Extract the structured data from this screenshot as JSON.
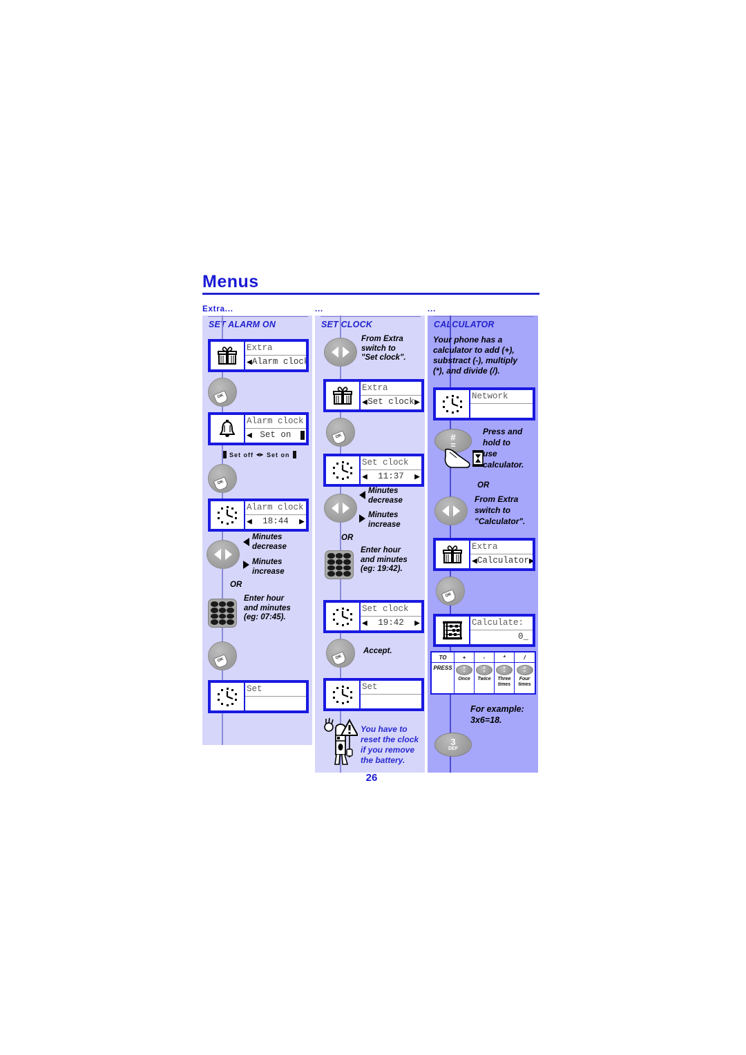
{
  "page": {
    "title": "Menus",
    "number": "26"
  },
  "columns": [
    {
      "header": "Extra...",
      "title": "SET ALARM ON",
      "steps": {
        "screen1": {
          "icon": "gift-icon",
          "line_top": "Extra",
          "line_bottom": "Alarm clock"
        },
        "key1": {
          "icon": "ok-key",
          "label": "OK"
        },
        "screen2": {
          "icon": "bell-icon",
          "line_top": "Alarm clock",
          "line_bottom": "Set on"
        },
        "toggle_hint": {
          "left": "Set off",
          "right": "Set on"
        },
        "key2": {
          "icon": "ok-key",
          "label": "OK"
        },
        "screen3": {
          "icon": "clock-icon",
          "line_top": "Alarm clock",
          "line_bottom": "18:44"
        },
        "nav_key": {
          "icon": "left-right-key"
        },
        "callout_dec": "Minutes\ndecrease",
        "callout_dec_l1": "Minutes",
        "callout_dec_l2": "decrease",
        "callout_inc_l1": "Minutes",
        "callout_inc_l2": "increase",
        "or": "OR",
        "keypad": {
          "icon": "keypad-icon"
        },
        "callout_enter_l1": "Enter hour",
        "callout_enter_l2": "and minutes",
        "callout_enter_l3": "(eg: 07:45).",
        "key3": {
          "icon": "ok-key",
          "label": "OK"
        },
        "screen4": {
          "icon": "clock-icon",
          "line_top": "Set",
          "line_bottom": ""
        }
      }
    },
    {
      "header": "...",
      "title": "SET CLOCK",
      "steps": {
        "nav_key_top": {
          "icon": "left-right-key"
        },
        "callout_from_l1": "From Extra",
        "callout_from_l2": "switch to",
        "callout_from_l3": "\"Set clock\".",
        "screen1": {
          "icon": "gift-icon",
          "line_top": "Extra",
          "line_bottom": "Set clock"
        },
        "key1": {
          "icon": "ok-key",
          "label": "OK"
        },
        "screen2": {
          "icon": "clock-icon",
          "line_top": "Set clock",
          "line_bottom": "11:37"
        },
        "nav_key": {
          "icon": "left-right-key"
        },
        "callout_dec_l1": "Minutes",
        "callout_dec_l2": "decrease",
        "callout_inc_l1": "Minutes",
        "callout_inc_l2": "increase",
        "or": "OR",
        "keypad": {
          "icon": "keypad-icon"
        },
        "callout_enter_l1": "Enter hour",
        "callout_enter_l2": "and minutes",
        "callout_enter_l3": "(eg: 19:42).",
        "screen3": {
          "icon": "clock-icon",
          "line_top": "Set clock",
          "line_bottom": "19:42"
        },
        "key2": {
          "icon": "ok-key",
          "label": "OK"
        },
        "callout_accept": "Accept.",
        "screen4": {
          "icon": "clock-icon",
          "line_top": "Set",
          "line_bottom": ""
        },
        "warning": {
          "icon": "warning-character-icon",
          "l1": "You have to",
          "l2": "reset the clock",
          "l3": "if you remove",
          "l4": "the battery."
        }
      }
    },
    {
      "header": "...",
      "title": "CALCULATOR",
      "steps": {
        "intro_l1": "Your phone has a",
        "intro_l2": "calculator to add (+),",
        "intro_l3": "substract (-), multiply",
        "intro_l4": "(*), and divide (/).",
        "screen1": {
          "icon": "clock-icon",
          "line_top": "Network",
          "line_bottom": ""
        },
        "hash_key": {
          "icon": "hash-key",
          "top": "#",
          "bottom": "="
        },
        "hold_icon": "press-hold-icon",
        "callout_press_l1": "Press and",
        "callout_press_l2": "hold to",
        "callout_press_l3": "use",
        "callout_press_l4": "calculator.",
        "or": "OR",
        "nav_key": {
          "icon": "left-right-key"
        },
        "callout_from_l1": "From Extra",
        "callout_from_l2": "switch to",
        "callout_from_l3": "\"Calculator\".",
        "screen2": {
          "icon": "gift-icon",
          "line_top": "Extra",
          "line_bottom": "Calculator"
        },
        "key1": {
          "icon": "ok-key",
          "label": "OK"
        },
        "screen3": {
          "icon": "abacus-icon",
          "line_top": "Calculate:",
          "line_bottom": "0_"
        },
        "example_l1": "For example:",
        "example_l2": "3x6=18.",
        "digit_key": {
          "n": "3",
          "l": "DEF"
        }
      }
    }
  ],
  "calc_table": {
    "row_labels": [
      "TO",
      "PRESS"
    ],
    "operators": [
      "+",
      "-",
      "*",
      "/"
    ],
    "press_counts": [
      "Once",
      "Twice",
      "Three\ntimes",
      "Four\ntimes"
    ],
    "press_counts_l1": [
      "Once",
      "Twice",
      "Three",
      "Four"
    ],
    "press_counts_l2": [
      "",
      "",
      "times",
      "times"
    ],
    "minikey_top": "#",
    "minikey_bottom": "="
  },
  "colors": {
    "brand_blue": "#1a1ad6",
    "screen_border": "#1919e0",
    "panel_light": "#d6d6fb",
    "panel_dark": "#a6a6fb",
    "key_grey": "#a8a8a8"
  }
}
